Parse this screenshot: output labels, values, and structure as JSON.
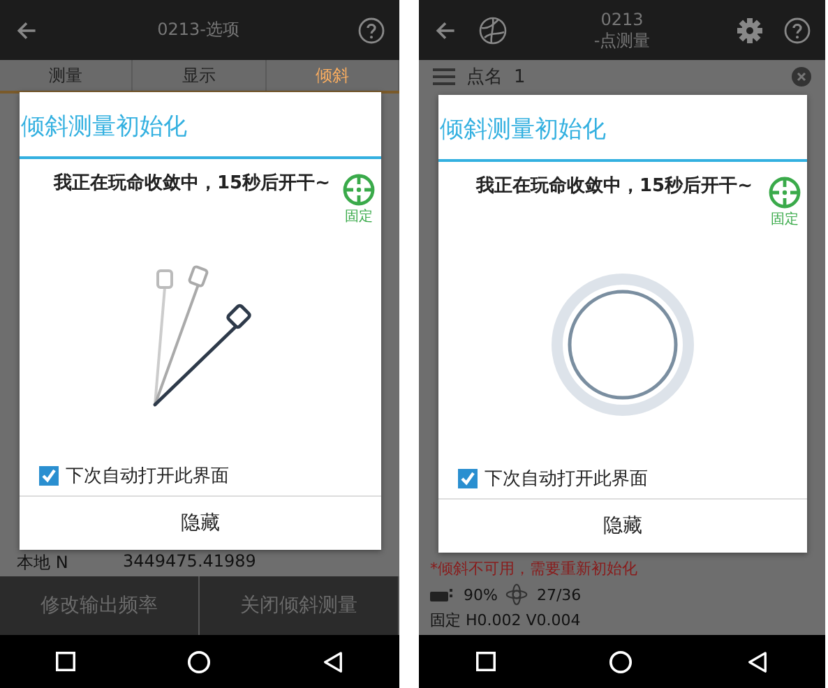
{
  "screens": [
    {
      "kind": "options",
      "header": {
        "title_lines": [
          "0213-选项"
        ]
      },
      "tabs": [
        {
          "label": "测量",
          "selected": false
        },
        {
          "label": "显示",
          "selected": false
        },
        {
          "label": "倾斜",
          "selected": true
        }
      ],
      "background_rows": [
        {
          "label": "本地 N",
          "value": "3449475.41989"
        }
      ],
      "footer_buttons": [
        "修改输出频率",
        "关闭倾斜测量"
      ],
      "dialog": {
        "title": "倾斜测量初始化",
        "message": "我正在玩命收敛中，15秒后开干~",
        "status_label": "固定",
        "checkbox": {
          "label": "下次自动打开此界面",
          "checked": true
        },
        "button": "隐藏"
      }
    },
    {
      "kind": "point",
      "header": {
        "title_lines": [
          "0213",
          "-点测量"
        ]
      },
      "point_name": {
        "label": "点名",
        "value": "1"
      },
      "dialog": {
        "title": "倾斜测量初始化",
        "message": "我正在玩命收敛中，15秒后开干~",
        "status_label": "固定",
        "checkbox": {
          "label": "下次自动打开此界面",
          "checked": true
        },
        "button": "隐藏"
      },
      "status": {
        "warning": "*倾斜不可用，需要重新初始化",
        "battery": "90%",
        "satellites": "27/36",
        "solution": "固定 H0.002 V0.004"
      }
    }
  ]
}
